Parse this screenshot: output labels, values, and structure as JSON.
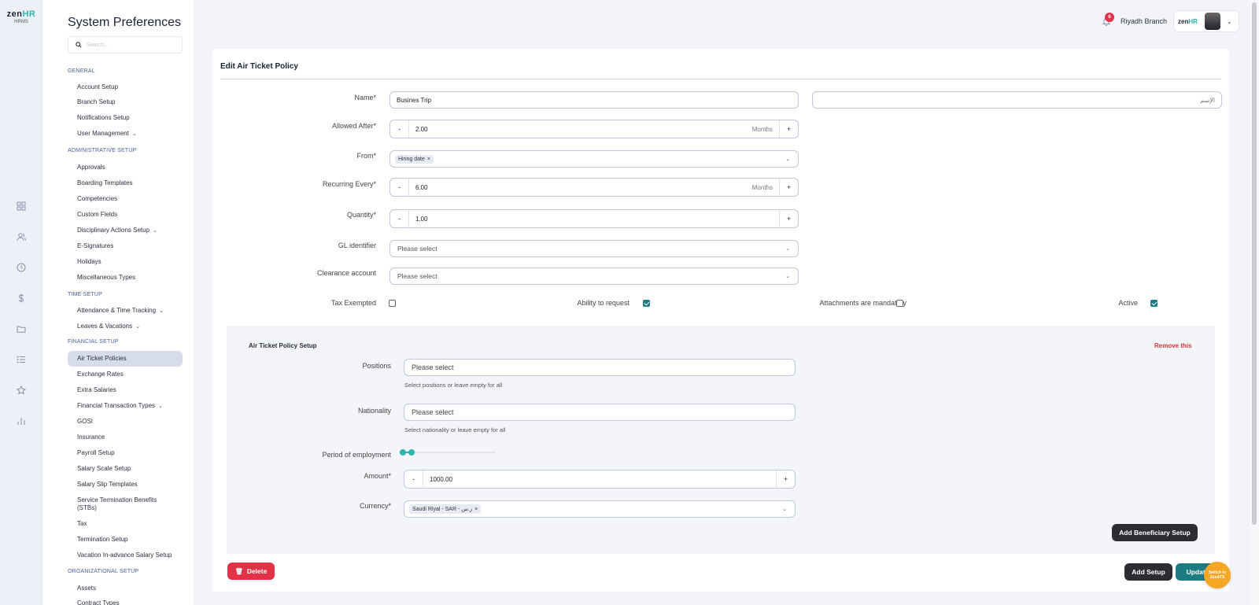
{
  "brand": {
    "logo_zen": "zen",
    "logo_hr": "HR",
    "product": "HRMS"
  },
  "rail": {
    "icons": [
      "grid-icon",
      "users-icon",
      "clock-icon",
      "dollar-icon",
      "folder-icon",
      "list-icon",
      "star-icon",
      "bar-chart-icon"
    ]
  },
  "sidebar": {
    "title": "System Preferences",
    "search_placeholder": "Search...",
    "sections": {
      "general": "GENERAL",
      "administrative": "ADMINISTRATIVE SETUP",
      "time": "TIME SETUP",
      "financial": "FINANCIAL SETUP",
      "organizational": "ORGANIZATIONAL SETUP"
    },
    "items": {
      "account_setup": "Account Setup",
      "branch_setup": "Branch Setup",
      "notifications_setup": "Notifications Setup",
      "user_management": "User Management",
      "approvals": "Approvals",
      "boarding_templates": "Boarding Templates",
      "competencies": "Competencies",
      "custom_fields": "Custom Fields",
      "disciplinary_actions_setup": "Disciplinary Actions Setup",
      "e_signatures": "E-Signatures",
      "holidays": "Holidays",
      "miscellaneous_types": "Miscellaneous Types",
      "attendance_time_tracking": "Attendance & Time Tracking",
      "leaves_vacations": "Leaves & Vacations",
      "air_ticket_policies": "Air Ticket Policies",
      "exchange_rates": "Exchange Rates",
      "extra_salaries": "Extra Salaries",
      "financial_transaction_types": "Financial Transaction Types",
      "gosi": "GOSI",
      "insurance": "Insurance",
      "payroll_setup": "Payroll Setup",
      "salary_scale_setup": "Salary Scale Setup",
      "salary_slip_templates": "Salary Slip Templates",
      "service_termination_benefits": "Service Termination Benefits (STBs)",
      "tax": "Tax",
      "termination_setup": "Termination Setup",
      "vacation_in_advance_salary_setup": "Vacation In-advance Salary Setup",
      "assets": "Assets",
      "contract_types": "Contract Types"
    }
  },
  "header": {
    "notification_count": "6",
    "branch": "Riyadh Branch"
  },
  "form": {
    "title": "Edit Air Ticket Policy",
    "name_label": "Name",
    "name_value": "Busines Trip",
    "name_ar_placeholder": "الإسم",
    "allowed_after_label": "Allowed After",
    "allowed_after_value": "2.00",
    "allowed_after_unit": "Months",
    "from_label": "From",
    "from_tag": "Hiring date",
    "recurring_label": "Recurring Every",
    "recurring_value": "6.00",
    "recurring_unit": "Months",
    "quantity_label": "Quantity",
    "quantity_value": "1.00",
    "gl_label": "GL identifier",
    "gl_placeholder": "Please select",
    "clearance_label": "Clearance account",
    "clearance_placeholder": "Please select",
    "tax_exempted_label": "Tax Exempted",
    "tax_exempted": false,
    "ability_label": "Ability to request",
    "ability": true,
    "attachments_label": "Attachments are mandatory",
    "attachments": false,
    "active_label": "Active",
    "active": true,
    "minus": "-",
    "plus": "+",
    "required": "*"
  },
  "setup": {
    "title": "Air Ticket Policy Setup",
    "remove": "Remove this",
    "positions_label": "Positions",
    "positions_placeholder": "Please select",
    "positions_hint": "Select positions or leave empty for all",
    "nationality_label": "Nationality",
    "nationality_placeholder": "Please select",
    "nationality_hint": "Select nationality or leave empty for all",
    "period_label": "Period of employment",
    "amount_label": "Amount",
    "amount_value": "1000.00",
    "currency_label": "Currency",
    "currency_tag": "Saudi Riyal - SAR - ر.س",
    "add_beneficiary": "Add Beneficiary Setup"
  },
  "actions": {
    "delete": "Delete",
    "add_setup": "Add Setup",
    "update": "Update",
    "switch": "Switch to ZenATS"
  },
  "colors": {
    "accent": "#1e7b84",
    "danger": "#e23248",
    "brand_teal": "#2fb3aa",
    "fab": "#f5a623"
  }
}
